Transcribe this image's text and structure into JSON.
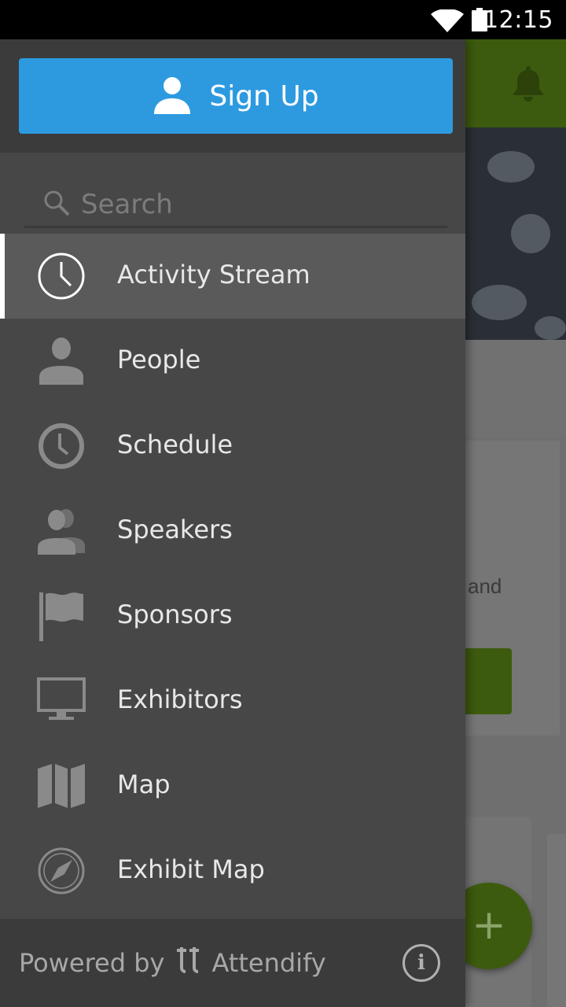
{
  "status_bar": {
    "time": "12:15",
    "wifi_icon": "wifi-icon",
    "battery_icon": "battery-icon"
  },
  "background_app": {
    "partial_text": "and",
    "fab_label": "+",
    "accent_color": "#3d5b0e"
  },
  "drawer": {
    "signup_label": "Sign Up",
    "signup_color": "#2d9ae0",
    "search": {
      "placeholder": "Search",
      "value": ""
    },
    "items": [
      {
        "label": "Activity Stream",
        "icon": "activity-clock-icon",
        "active": true
      },
      {
        "label": "People",
        "icon": "person-icon",
        "active": false
      },
      {
        "label": "Schedule",
        "icon": "clock-icon",
        "active": false
      },
      {
        "label": "Speakers",
        "icon": "speakers-icon",
        "active": false
      },
      {
        "label": "Sponsors",
        "icon": "flag-icon",
        "active": false
      },
      {
        "label": "Exhibitors",
        "icon": "monitor-icon",
        "active": false
      },
      {
        "label": "Map",
        "icon": "map-icon",
        "active": false
      },
      {
        "label": "Exhibit Map",
        "icon": "compass-icon",
        "active": false
      }
    ],
    "footer": {
      "powered_by": "Powered by",
      "brand": "Attendify",
      "info_label": "i"
    }
  }
}
